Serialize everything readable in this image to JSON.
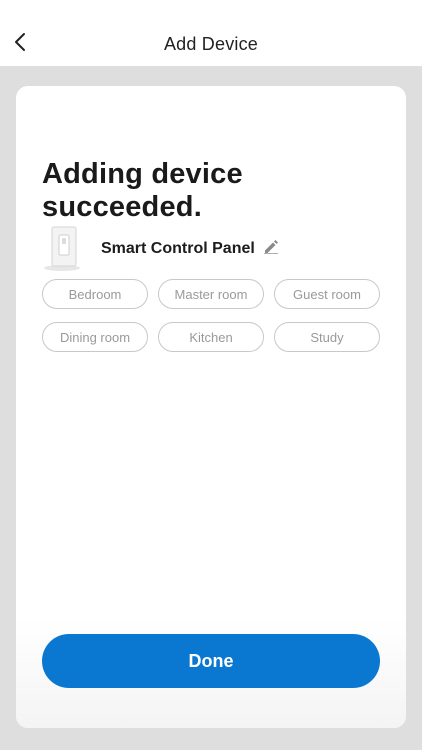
{
  "header": {
    "title": "Add Device",
    "back_icon": "chevron-left-icon"
  },
  "card": {
    "heading": "Adding device succeeded.",
    "device": {
      "name": "Smart Control Panel",
      "edit_icon": "pencil-icon"
    },
    "rooms": [
      {
        "label": "Bedroom"
      },
      {
        "label": "Master room"
      },
      {
        "label": "Guest room"
      },
      {
        "label": "Dining room"
      },
      {
        "label": "Kitchen"
      },
      {
        "label": "Study"
      }
    ],
    "done_label": "Done"
  },
  "colors": {
    "accent": "#0a78d1",
    "chip_border": "#c8c8c8",
    "chip_text": "#9a9a9a",
    "page_bg": "#dedede"
  }
}
